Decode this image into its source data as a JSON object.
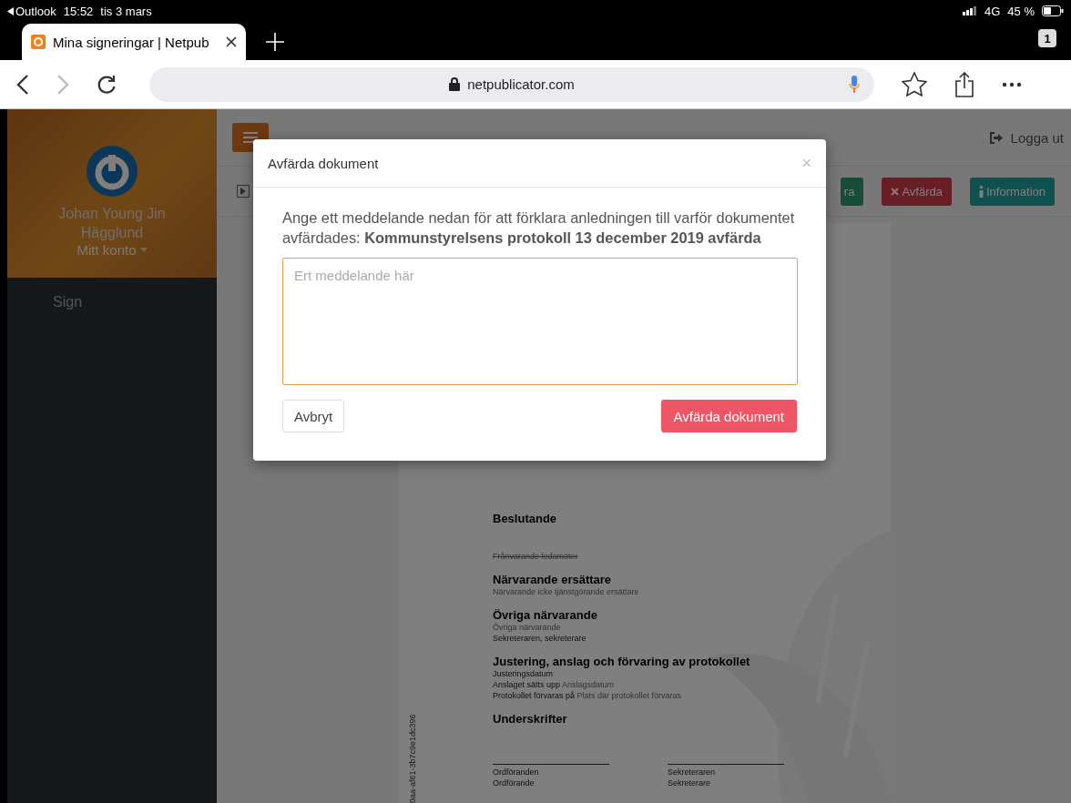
{
  "status_bar": {
    "back_app": "Outlook",
    "time": "15:52",
    "date": "tis 3 mars",
    "network": "4G",
    "battery": "45 %"
  },
  "browser": {
    "tabs": [
      {
        "title": "Mina signeringar | Netpub",
        "selected": true
      }
    ],
    "tab_count": "1",
    "url": "netpublicator.com"
  },
  "sidebar": {
    "user_name": "Johan Young Jin Hägglund",
    "account_menu": "Mitt konto",
    "items": [
      {
        "label": "Sign",
        "selected": false
      }
    ]
  },
  "header": {
    "logout": "Logga ut"
  },
  "toolbar": {
    "buttons": [
      {
        "label": "ra",
        "kind": "success"
      },
      {
        "label": "Avfärda",
        "kind": "danger"
      },
      {
        "label": "Information",
        "kind": "info"
      }
    ]
  },
  "document": {
    "sections": [
      {
        "heading": "Beslutande"
      },
      {
        "lines": [
          {
            "text": "Frånvarande ledamöter",
            "kind": "struck"
          }
        ]
      },
      {
        "heading": "Närvarande ersättare",
        "lines": [
          {
            "value": "Närvarande icke tjänstgörande ersättare",
            "kind": "plain"
          }
        ]
      },
      {
        "heading": "Övriga närvarande",
        "lines": [
          {
            "value": "Övriga närvarande",
            "kind": "plain"
          },
          {
            "text": "Sekreteraren, sekreterare",
            "kind": "plain"
          }
        ]
      },
      {
        "heading": "Justering, anslag och förvaring av protokollet",
        "lines": [
          {
            "text": "Justeringsdatum",
            "kind": "plain"
          },
          {
            "text": "Anslaget sätts upp",
            "value": "Anslagsdatum",
            "kind": "plain"
          },
          {
            "text": "Protokollet förvaras på",
            "value": "Plats där protokollet förvaras",
            "kind": "plain"
          }
        ]
      },
      {
        "heading": "Underskrifter"
      }
    ],
    "signatures": [
      {
        "role": "Ordföranden",
        "title": "Ordförande"
      },
      {
        "role": "Sekreteraren",
        "title": "Sekreterare"
      }
    ],
    "side_id": "0aa-af61-3b7c9e1dc396"
  },
  "modal": {
    "title": "Avfärda dokument",
    "close": "×",
    "message": "Ange ett meddelande nedan för att förklara anledningen till varför dokumentet avfärdades: **Kommunstyrelsens protokoll 13 december 2019 avfärda**",
    "textarea": {
      "placeholder": "Ert meddelande här"
    },
    "cancel": "Avbryt",
    "confirm": "Avfärda dokument"
  }
}
